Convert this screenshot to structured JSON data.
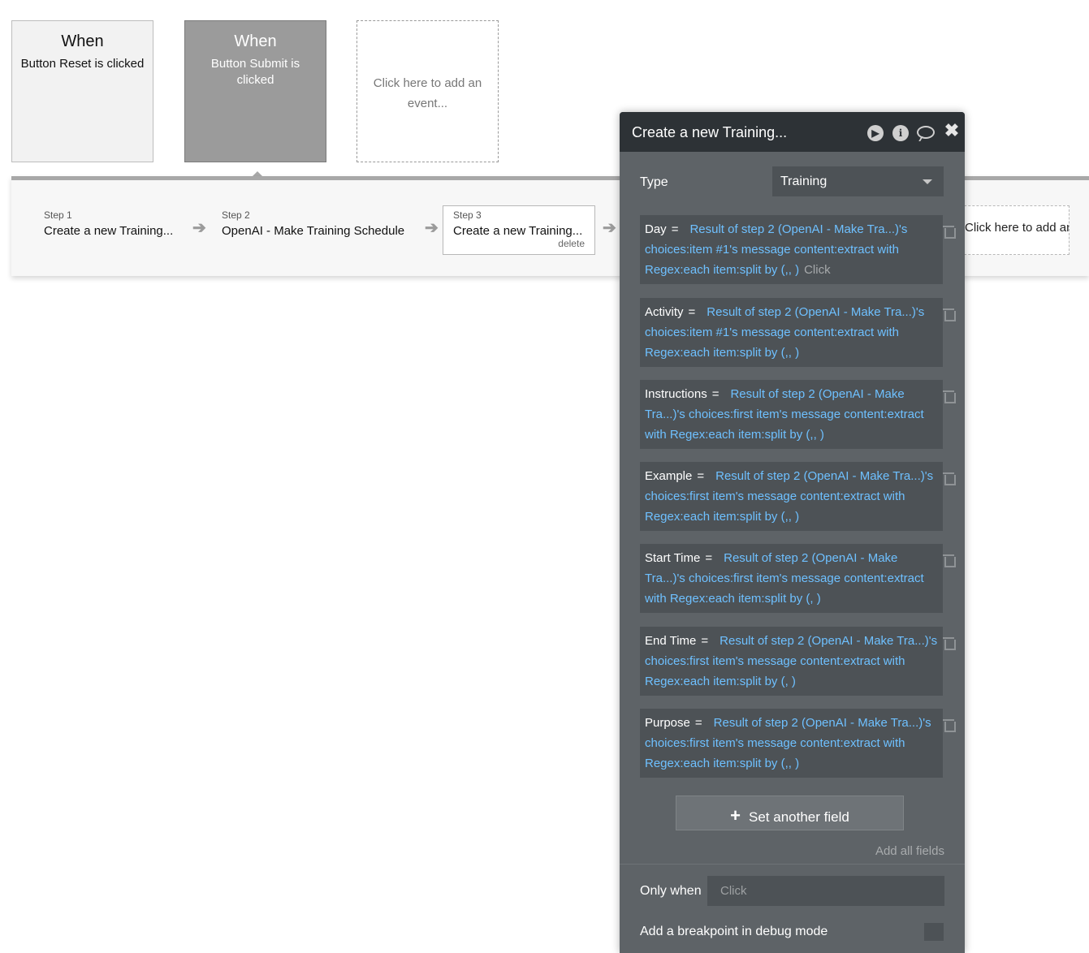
{
  "events": [
    {
      "when": "When",
      "description": "Button Reset is clicked"
    },
    {
      "when": "When",
      "description": "Button Submit is clicked"
    },
    {
      "description": "Click here to add an event..."
    }
  ],
  "workflow": {
    "steps": [
      {
        "num": "Step 1",
        "name": "Create a new Training..."
      },
      {
        "num": "Step 2",
        "name": "OpenAI - Make Training Schedule"
      },
      {
        "num": "Step 3",
        "name": "Create a new Training...",
        "delete_label": "delete"
      }
    ],
    "add_action": "Click here to add an action..."
  },
  "panel": {
    "title": "Create a new Training...",
    "type_label": "Type",
    "type_value": "Training",
    "fields": [
      {
        "name": "Day",
        "eq": "=",
        "expr": "Result of step 2 (OpenAI - Make Tra...)'s choices:item #1's message content:extract with Regex:each item:split by (,, )",
        "hint": "Click"
      },
      {
        "name": "Activity",
        "eq": "=",
        "expr": "Result of step 2 (OpenAI - Make Tra...)'s choices:item #1's message content:extract with Regex:each item:split by (,, )"
      },
      {
        "name": "Instructions",
        "eq": "=",
        "expr": "Result of step 2 (OpenAI - Make Tra...)'s choices:first item's message content:extract with Regex:each item:split by (,, )"
      },
      {
        "name": "Example",
        "eq": "=",
        "expr": "Result of step 2 (OpenAI - Make Tra...)'s choices:first item's message content:extract with Regex:each item:split by (,, )"
      },
      {
        "name": "Start Time",
        "eq": "=",
        "expr": "Result of step 2 (OpenAI - Make Tra...)'s choices:first item's message content:extract with Regex:each item:split by (, )"
      },
      {
        "name": "End Time",
        "eq": "=",
        "expr": "Result of step 2 (OpenAI - Make Tra...)'s choices:first item's message content:extract with Regex:each item:split by (, )"
      },
      {
        "name": "Purpose",
        "eq": "=",
        "expr": "Result of step 2 (OpenAI - Make Tra...)'s choices:first item's message content:extract with Regex:each item:split by (,, )"
      }
    ],
    "set_another_field": "Set another field",
    "add_all_fields": "Add all fields",
    "only_when_label": "Only when",
    "only_when_placeholder": "Click",
    "breakpoint_label": "Add a breakpoint in debug mode"
  }
}
